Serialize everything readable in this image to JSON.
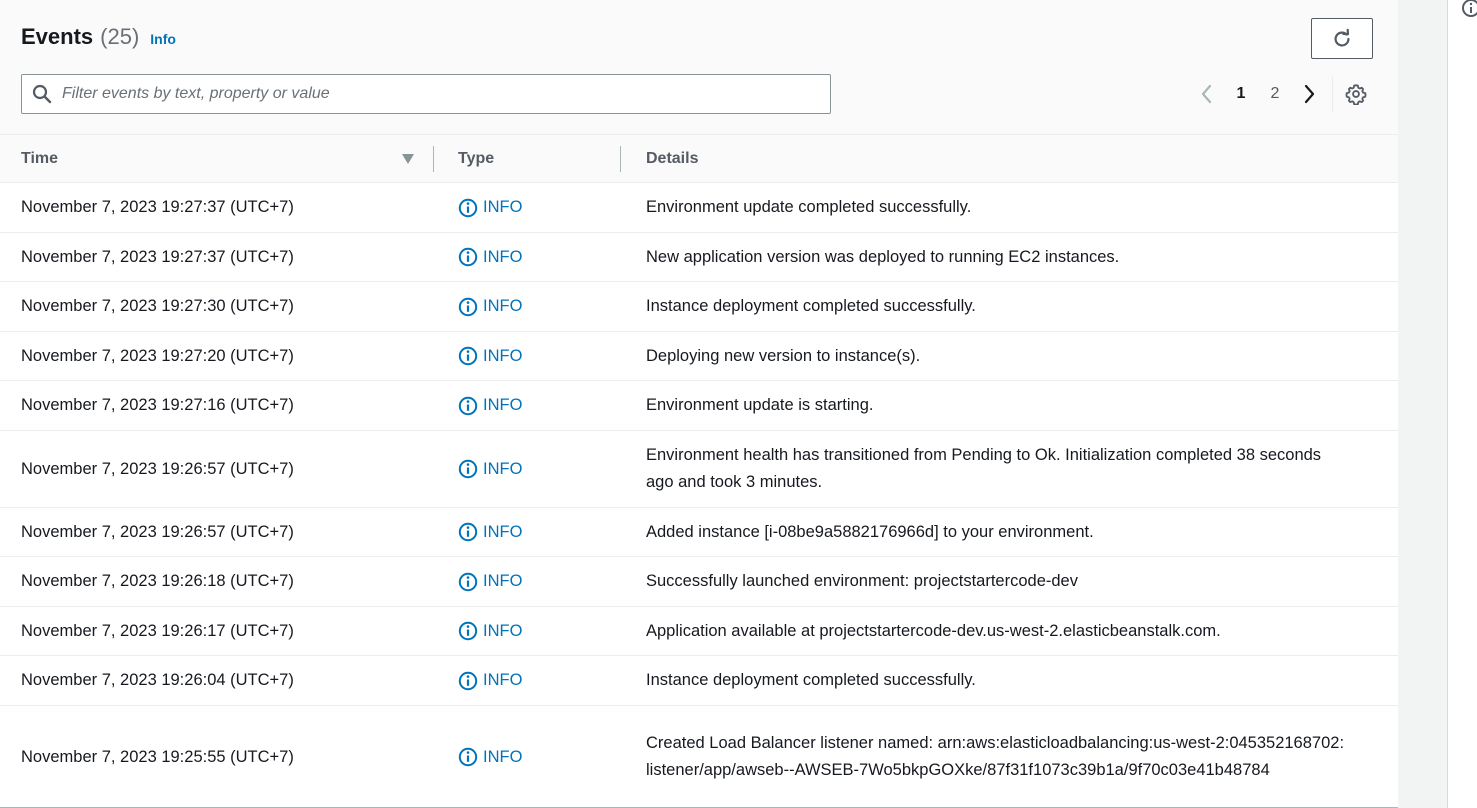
{
  "header": {
    "title": "Events",
    "count": "(25)",
    "info_link": "Info"
  },
  "search": {
    "placeholder": "Filter events by text, property or value",
    "value": ""
  },
  "pagination": {
    "pages": [
      "1",
      "2"
    ],
    "current": "1"
  },
  "table": {
    "columns": [
      "Time",
      "Type",
      "Details"
    ],
    "sorted_column": "Time",
    "rows": [
      {
        "time": "November 7, 2023 19:27:37 (UTC+7)",
        "type": "INFO",
        "details": "Environment update completed successfully."
      },
      {
        "time": "November 7, 2023 19:27:37 (UTC+7)",
        "type": "INFO",
        "details": "New application version was deployed to running EC2 instances."
      },
      {
        "time": "November 7, 2023 19:27:30 (UTC+7)",
        "type": "INFO",
        "details": "Instance deployment completed successfully."
      },
      {
        "time": "November 7, 2023 19:27:20 (UTC+7)",
        "type": "INFO",
        "details": "Deploying new version to instance(s)."
      },
      {
        "time": "November 7, 2023 19:27:16 (UTC+7)",
        "type": "INFO",
        "details": "Environment update is starting."
      },
      {
        "time": "November 7, 2023 19:26:57 (UTC+7)",
        "type": "INFO",
        "details": "Environment health has transitioned from Pending to Ok. Initialization completed 38 seconds ago and took 3 minutes."
      },
      {
        "time": "November 7, 2023 19:26:57 (UTC+7)",
        "type": "INFO",
        "details": "Added instance [i-08be9a5882176966d] to your environment."
      },
      {
        "time": "November 7, 2023 19:26:18 (UTC+7)",
        "type": "INFO",
        "details": "Successfully launched environment: projectstartercode-dev"
      },
      {
        "time": "November 7, 2023 19:26:17 (UTC+7)",
        "type": "INFO",
        "details": "Application available at projectstartercode-dev.us-west-2.elasticbeanstalk.com."
      },
      {
        "time": "November 7, 2023 19:26:04 (UTC+7)",
        "type": "INFO",
        "details": "Instance deployment completed successfully."
      },
      {
        "time": "November 7, 2023 19:25:55 (UTC+7)",
        "type": "INFO",
        "details": "Created Load Balancer listener named: arn:aws:elasticloadbalancing:us-west-2:045352168702:listener/app/awseb--AWSEB-7Wo5bkpGOXke/87f31f1073c39b1a/9f70c03e41b48784"
      }
    ]
  },
  "icons": {
    "refresh": "refresh-icon",
    "search": "search-icon",
    "prev": "chevron-left-icon",
    "next": "chevron-right-icon",
    "settings": "gear-icon",
    "type": "info-circle-icon",
    "sort": "caret-down-icon"
  },
  "colors": {
    "link": "#0073bb",
    "text": "#16191f",
    "muted": "#687078"
  }
}
